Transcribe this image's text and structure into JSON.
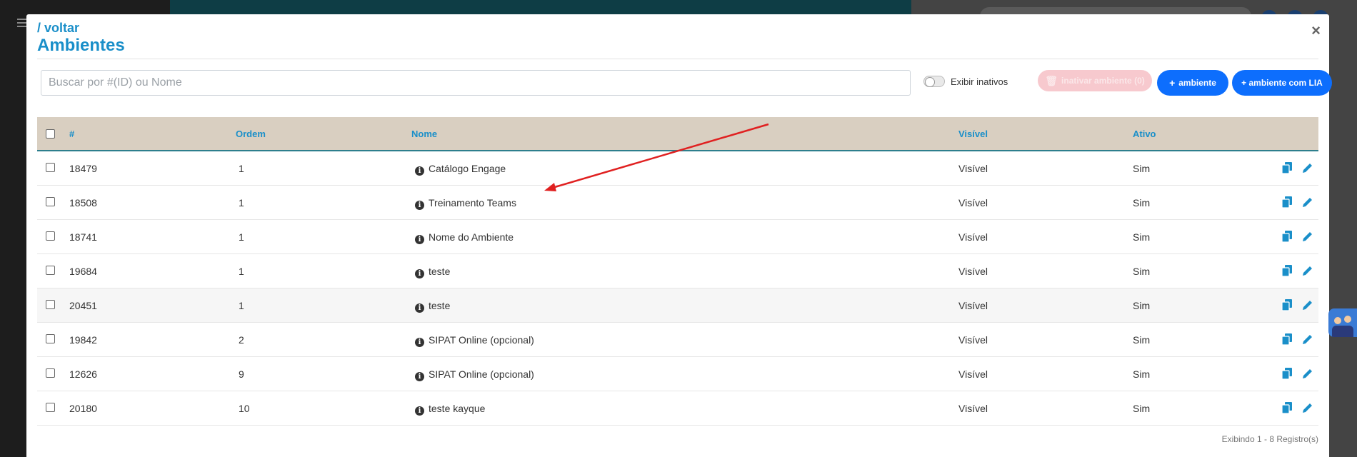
{
  "header": {
    "back_label": "/ voltar",
    "title": "Ambientes",
    "close_label": "×"
  },
  "toolbar": {
    "search_placeholder": "Buscar por #(ID) ou Nome",
    "search_value": "",
    "show_inactive_label": "Exibir inativos",
    "show_inactive_checked": false,
    "inactivate_label": "inativar ambiente (0)",
    "add_label": "ambiente",
    "add_with_lia_label": "+ ambiente com LIA"
  },
  "table": {
    "headers": {
      "id": "#",
      "order": "Ordem",
      "name": "Nome",
      "visible": "Visível",
      "active": "Ativo"
    },
    "rows": [
      {
        "id": "18479",
        "order": "1",
        "name": "Catálogo Engage",
        "visible": "Visível",
        "active": "Sim"
      },
      {
        "id": "18508",
        "order": "1",
        "name": "Treinamento Teams",
        "visible": "Visível",
        "active": "Sim"
      },
      {
        "id": "18741",
        "order": "1",
        "name": "Nome do Ambiente",
        "visible": "Visível",
        "active": "Sim"
      },
      {
        "id": "19684",
        "order": "1",
        "name": "teste",
        "visible": "Visível",
        "active": "Sim"
      },
      {
        "id": "20451",
        "order": "1",
        "name": "teste",
        "visible": "Visível",
        "active": "Sim"
      },
      {
        "id": "19842",
        "order": "2",
        "name": "SIPAT Online (opcional)",
        "visible": "Visível",
        "active": "Sim"
      },
      {
        "id": "12626",
        "order": "9",
        "name": "SIPAT Online (opcional)",
        "visible": "Visível",
        "active": "Sim"
      }
    ]
  },
  "table_last_row": {
    "id": "20180",
    "order": "10",
    "name": "teste kayque",
    "visible": "Visível",
    "active": "Sim"
  },
  "footer": {
    "records_label": "Exibindo 1 - 8 Registro(s)"
  },
  "colors": {
    "accent": "#1a8fc9",
    "primary_button": "#0d6efd",
    "header_bg": "#d9cfc1",
    "annotation_arrow": "#e02020"
  }
}
